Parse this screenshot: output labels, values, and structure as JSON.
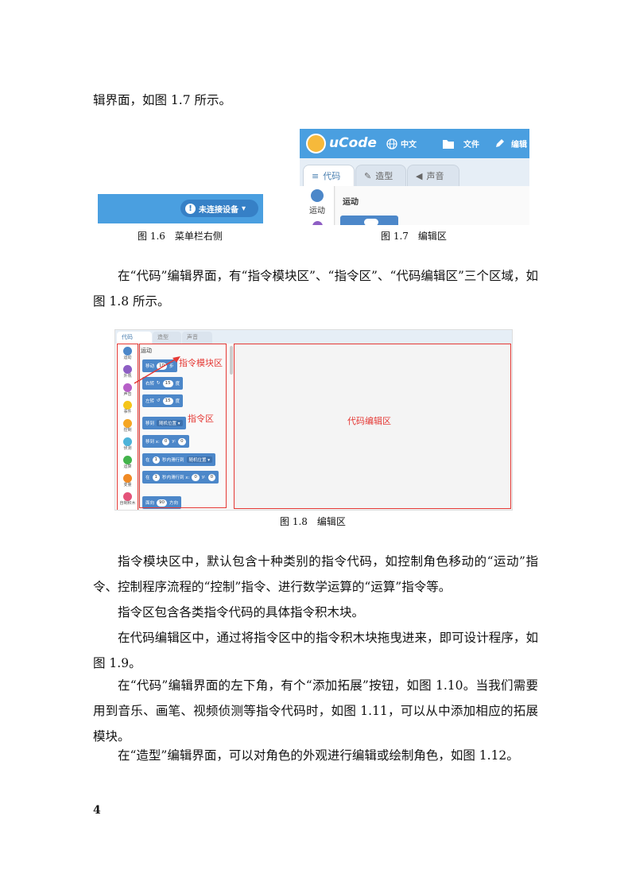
{
  "paragraphs": {
    "p0": "辑界面，如图 1.7 所示。",
    "p1": "在“代码”编辑界面，有“指令模块区”、“指令区”、“代码编辑区”三个区域，如图 1.8 所示。",
    "p2": "指令模块区中，默认包含十种类别的指令代码，如控制角色移动的“运动”指令、控制程序流程的“控制”指令、进行数学运算的“运算”指令等。",
    "p3": "指令区包含各类指令代码的具体指令积木块。",
    "p4": "在代码编辑区中，通过将指令区中的指令积木块拖曳进来，即可设计程序，如图 1.9。",
    "p5": "在“代码”编辑界面的左下角，有个“添加拓展”按钮，如图 1.10。当我们需要用到音乐、画笔、视频侦测等指令代码时，如图 1.11，可以从中添加相应的拓展模块。",
    "p6": "在“造型”编辑界面，可以对角色的外观进行编辑或绘制角色，如图 1.12。"
  },
  "captions": {
    "fig16": "图 1.6　菜单栏右侧",
    "fig17": "图 1.7　编辑区",
    "fig18": "图 1.8　编辑区"
  },
  "fig16": {
    "device_status": "未连接设备",
    "warn_glyph": "!",
    "dropdown_glyph": "▾"
  },
  "fig17": {
    "logo": "uCode",
    "language": "中文",
    "file": "文件",
    "edit": "编辑",
    "tabs": [
      "代码",
      "造型",
      "声音"
    ],
    "category": "运动",
    "section": "运动"
  },
  "fig18": {
    "tabs": [
      "代码",
      "造型",
      "声音"
    ],
    "categories": [
      {
        "label": "运动",
        "color": "#4c87c9"
      },
      {
        "label": "外观",
        "color": "#8e5ec4"
      },
      {
        "label": "声音",
        "color": "#b65fc7"
      },
      {
        "label": "事件",
        "color": "#f5c518"
      },
      {
        "label": "控制",
        "color": "#f5a623"
      },
      {
        "label": "侦测",
        "color": "#4cb3d9"
      },
      {
        "label": "运算",
        "color": "#43b34b"
      },
      {
        "label": "变量",
        "color": "#f08a24"
      },
      {
        "label": "自制积木",
        "color": "#e4537a"
      }
    ],
    "palette_title": "运动",
    "blocks": {
      "move": {
        "a": "移动",
        "v": "10",
        "b": "步"
      },
      "turn_right": {
        "a": "右转",
        "g": "↻",
        "v": "15",
        "b": "度"
      },
      "turn_left": {
        "a": "左转",
        "g": "↺",
        "v": "15",
        "b": "度"
      },
      "goto": {
        "a": "移到",
        "v": "随机位置 ▾"
      },
      "gotoxy": {
        "a": "移到 x:",
        "x": "0",
        "y_label": "y:",
        "y": "0"
      },
      "glide": {
        "a": "在",
        "v": "1",
        "b": "秒内滑行到",
        "c": "随机位置 ▾"
      },
      "glidexy": {
        "a": "在",
        "v": "1",
        "b": "秒内滑行到 x:",
        "x": "0",
        "y_label": "y:",
        "y": "0"
      },
      "point": {
        "a": "面向",
        "v": "90",
        "b": "方向"
      }
    },
    "labels": {
      "module_area": "指令模块区",
      "instruction_area": "指令区",
      "editor_area": "代码编辑区"
    }
  },
  "page_number": "4"
}
